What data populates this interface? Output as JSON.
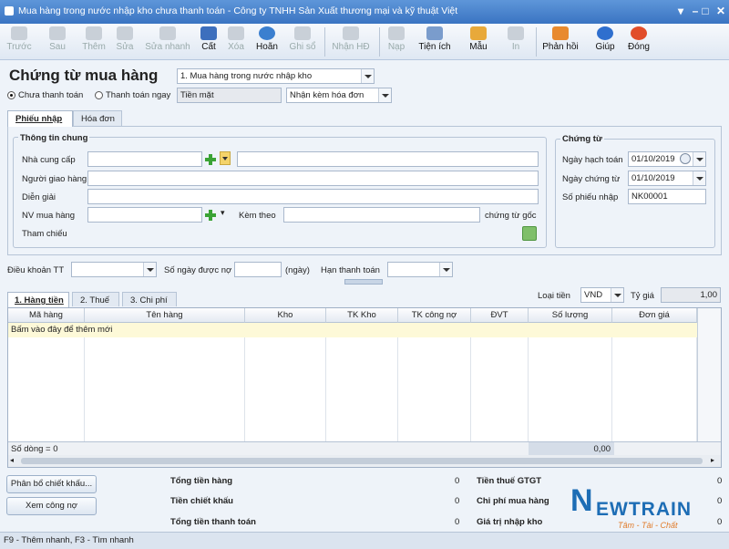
{
  "window": {
    "title": "Mua hàng trong nước nhập kho chưa thanh toán - Công ty TNHH Sản Xuất thương mại và kỹ thuật Việt"
  },
  "toolbar": {
    "prev": "Trước",
    "next": "Sau",
    "add": "Thêm",
    "edit": "Sửa",
    "quick_edit": "Sửa nhanh",
    "save": "Cất",
    "delete": "Xóa",
    "undo": "Hoãn",
    "post": "Ghi sổ",
    "receive_invoice": "Nhận HĐ",
    "load": "Nạp",
    "utilities": "Tiện ích",
    "template": "Mẫu",
    "print": "In",
    "feedback": "Phản hồi",
    "help": "Giúp",
    "close": "Đóng"
  },
  "header": {
    "title": "Chứng từ mua hàng",
    "type_value": "1. Mua hàng trong nước nhập kho",
    "radio_unpaid": "Chưa thanh toán",
    "radio_paid": "Thanh toán ngay",
    "payment_method": "Tiền mặt",
    "invoice_option": "Nhận kèm hóa đơn"
  },
  "tabs": {
    "receipt": "Phiếu nhập",
    "invoice": "Hóa đơn"
  },
  "general": {
    "legend": "Thông tin chung",
    "supplier": "Nhà cung cấp",
    "deliverer": "Người giao hàng",
    "description": "Diễn giải",
    "buyer": "NV mua hàng",
    "attach": "Kèm theo",
    "original_docs": "chứng từ gốc",
    "reference": "Tham chiếu"
  },
  "voucher": {
    "legend": "Chứng từ",
    "posting_date_label": "Ngày hạch toán",
    "posting_date": "01/10/2019",
    "voucher_date_label": "Ngày chứng từ",
    "voucher_date": "01/10/2019",
    "number_label": "Số phiếu nhập",
    "number": "NK00001"
  },
  "terms": {
    "payment_terms": "Điều khoản TT",
    "credit_days": "Số ngày được nợ",
    "days_unit": "(ngày)",
    "due_date": "Hạn thanh toán"
  },
  "detail_tabs": {
    "goods": "1. Hàng tiền",
    "tax": "2. Thuế",
    "cost": "3. Chi phí"
  },
  "currency": {
    "label": "Loại tiền",
    "value": "VND",
    "rate_label": "Tỷ giá",
    "rate": "1,00"
  },
  "grid": {
    "columns": [
      "Mã hàng",
      "Tên hàng",
      "Kho",
      "TK Kho",
      "TK công nợ",
      "ĐVT",
      "Số lượng",
      "Đơn giá"
    ],
    "new_row": "Bấm vào đây để thêm mới",
    "row_count": "Số dòng = 0",
    "total_qty": "0,00"
  },
  "buttons": {
    "allocate": "Phân bổ chiết khấu...",
    "view_debt": "Xem công nợ"
  },
  "summary": {
    "total_goods": "Tổng tiền hàng",
    "total_goods_val": "0",
    "discount": "Tiền chiết khấu",
    "discount_val": "0",
    "total_pay": "Tổng tiền thanh toán",
    "total_pay_val": "0",
    "vat": "Tiền thuế GTGT",
    "vat_val": "0",
    "purchase_cost": "Chi phí mua hàng",
    "purchase_cost_val": "0",
    "import_value": "Giá trị nhập kho",
    "import_value_val": "0"
  },
  "logo": {
    "text": "NEWTRAIN",
    "tagline": "Tâm - Tài - Chất"
  },
  "status": {
    "hint": "F9 - Thêm nhanh, F3 - Tìm nhanh"
  }
}
